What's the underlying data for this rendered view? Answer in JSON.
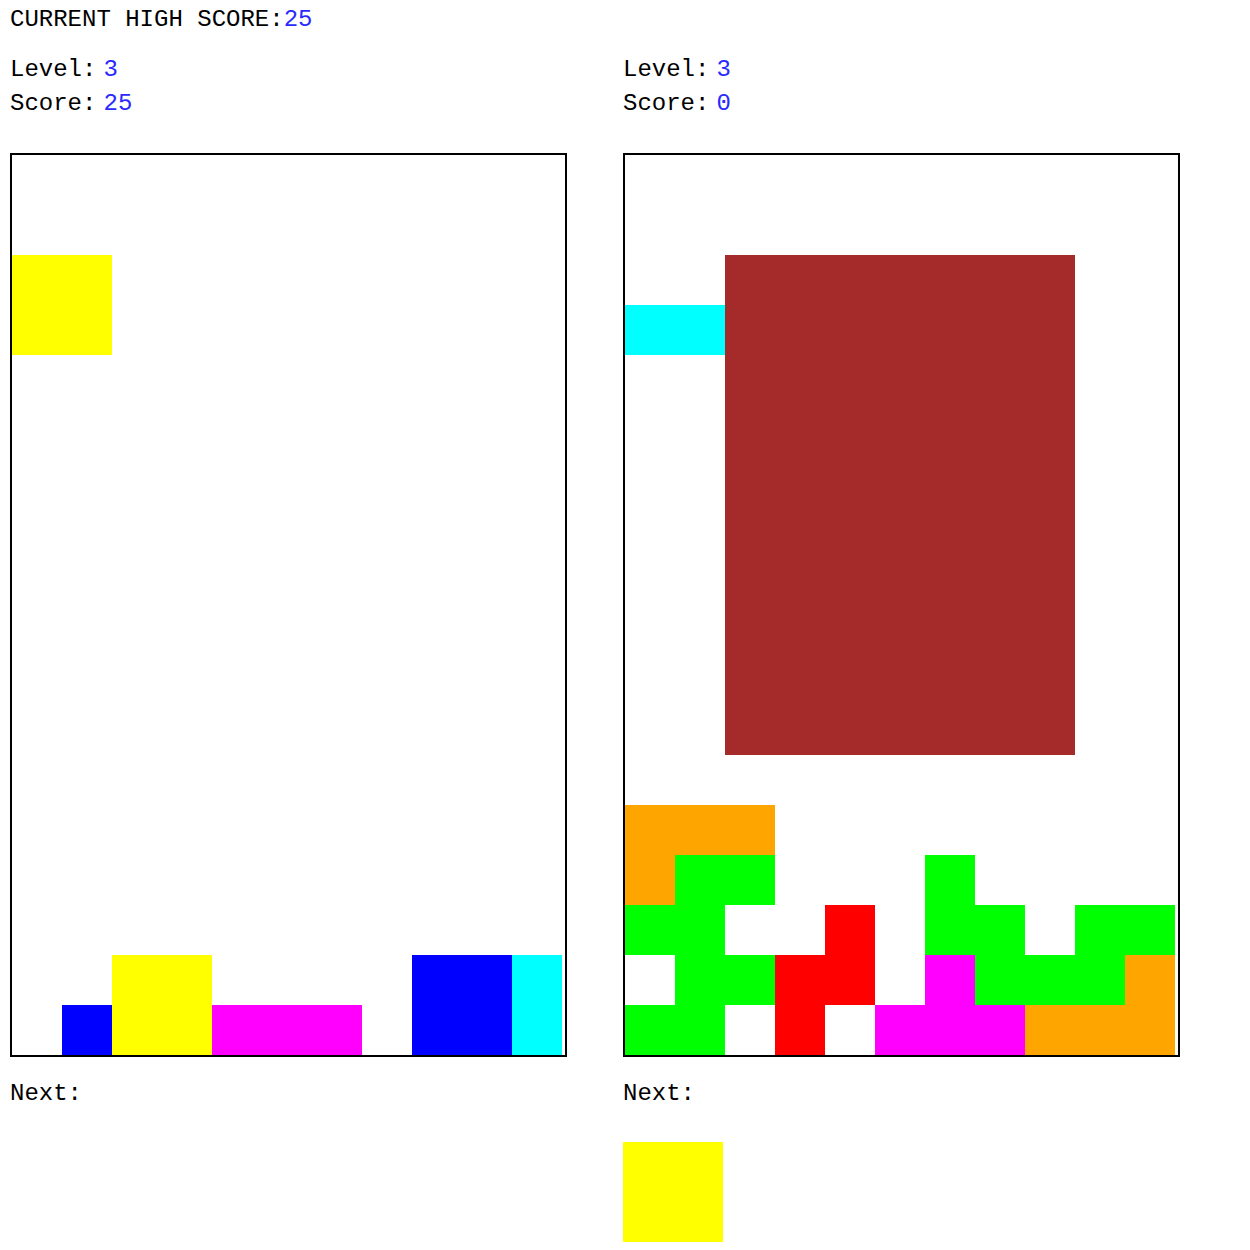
{
  "high_score": {
    "label": "CURRENT HIGH SCORE:",
    "value": "25"
  },
  "palette": {
    "Y": "#ffff00",
    "C": "#00ffff",
    "B": "#0000ff",
    "M": "#ff00ff",
    "O": "#ffa500",
    "G": "#00ff00",
    "R": "#ff0000",
    "N": "#a52a2a"
  },
  "players": [
    {
      "level_label": "Level:",
      "level": "3",
      "score_label": "Score:",
      "score": "25",
      "board": [
        "...........",
        "...........",
        "YY.........",
        "YY.........",
        "...........",
        "...........",
        "...........",
        "...........",
        "...........",
        "...........",
        "...........",
        "...........",
        "...........",
        "...........",
        "...........",
        "...........",
        "..YY....BBC",
        ".BYYMMM.BBC"
      ],
      "next_label": "Next:",
      "next": []
    },
    {
      "level_label": "Level:",
      "level": "3",
      "score_label": "Score:",
      "score": "0",
      "board": [
        "...........",
        "...........",
        "..NNNNNNN..",
        "CCNNNNNNN..",
        "..NNNNNNN..",
        "..NNNNNNN..",
        "..NNNNNNN..",
        "..NNNNNNN..",
        "..NNNNNNN..",
        "..NNNNNNN..",
        "..NNNNNNN..",
        "..NNNNNNN..",
        "...........",
        "OOO........",
        "OGG...G....",
        "GG..R.GG.GG",
        ".GGRR.MGGGO",
        "GG.R.MMMOOO"
      ],
      "next_label": "Next:",
      "next": [
        "YY",
        "YY"
      ]
    }
  ]
}
